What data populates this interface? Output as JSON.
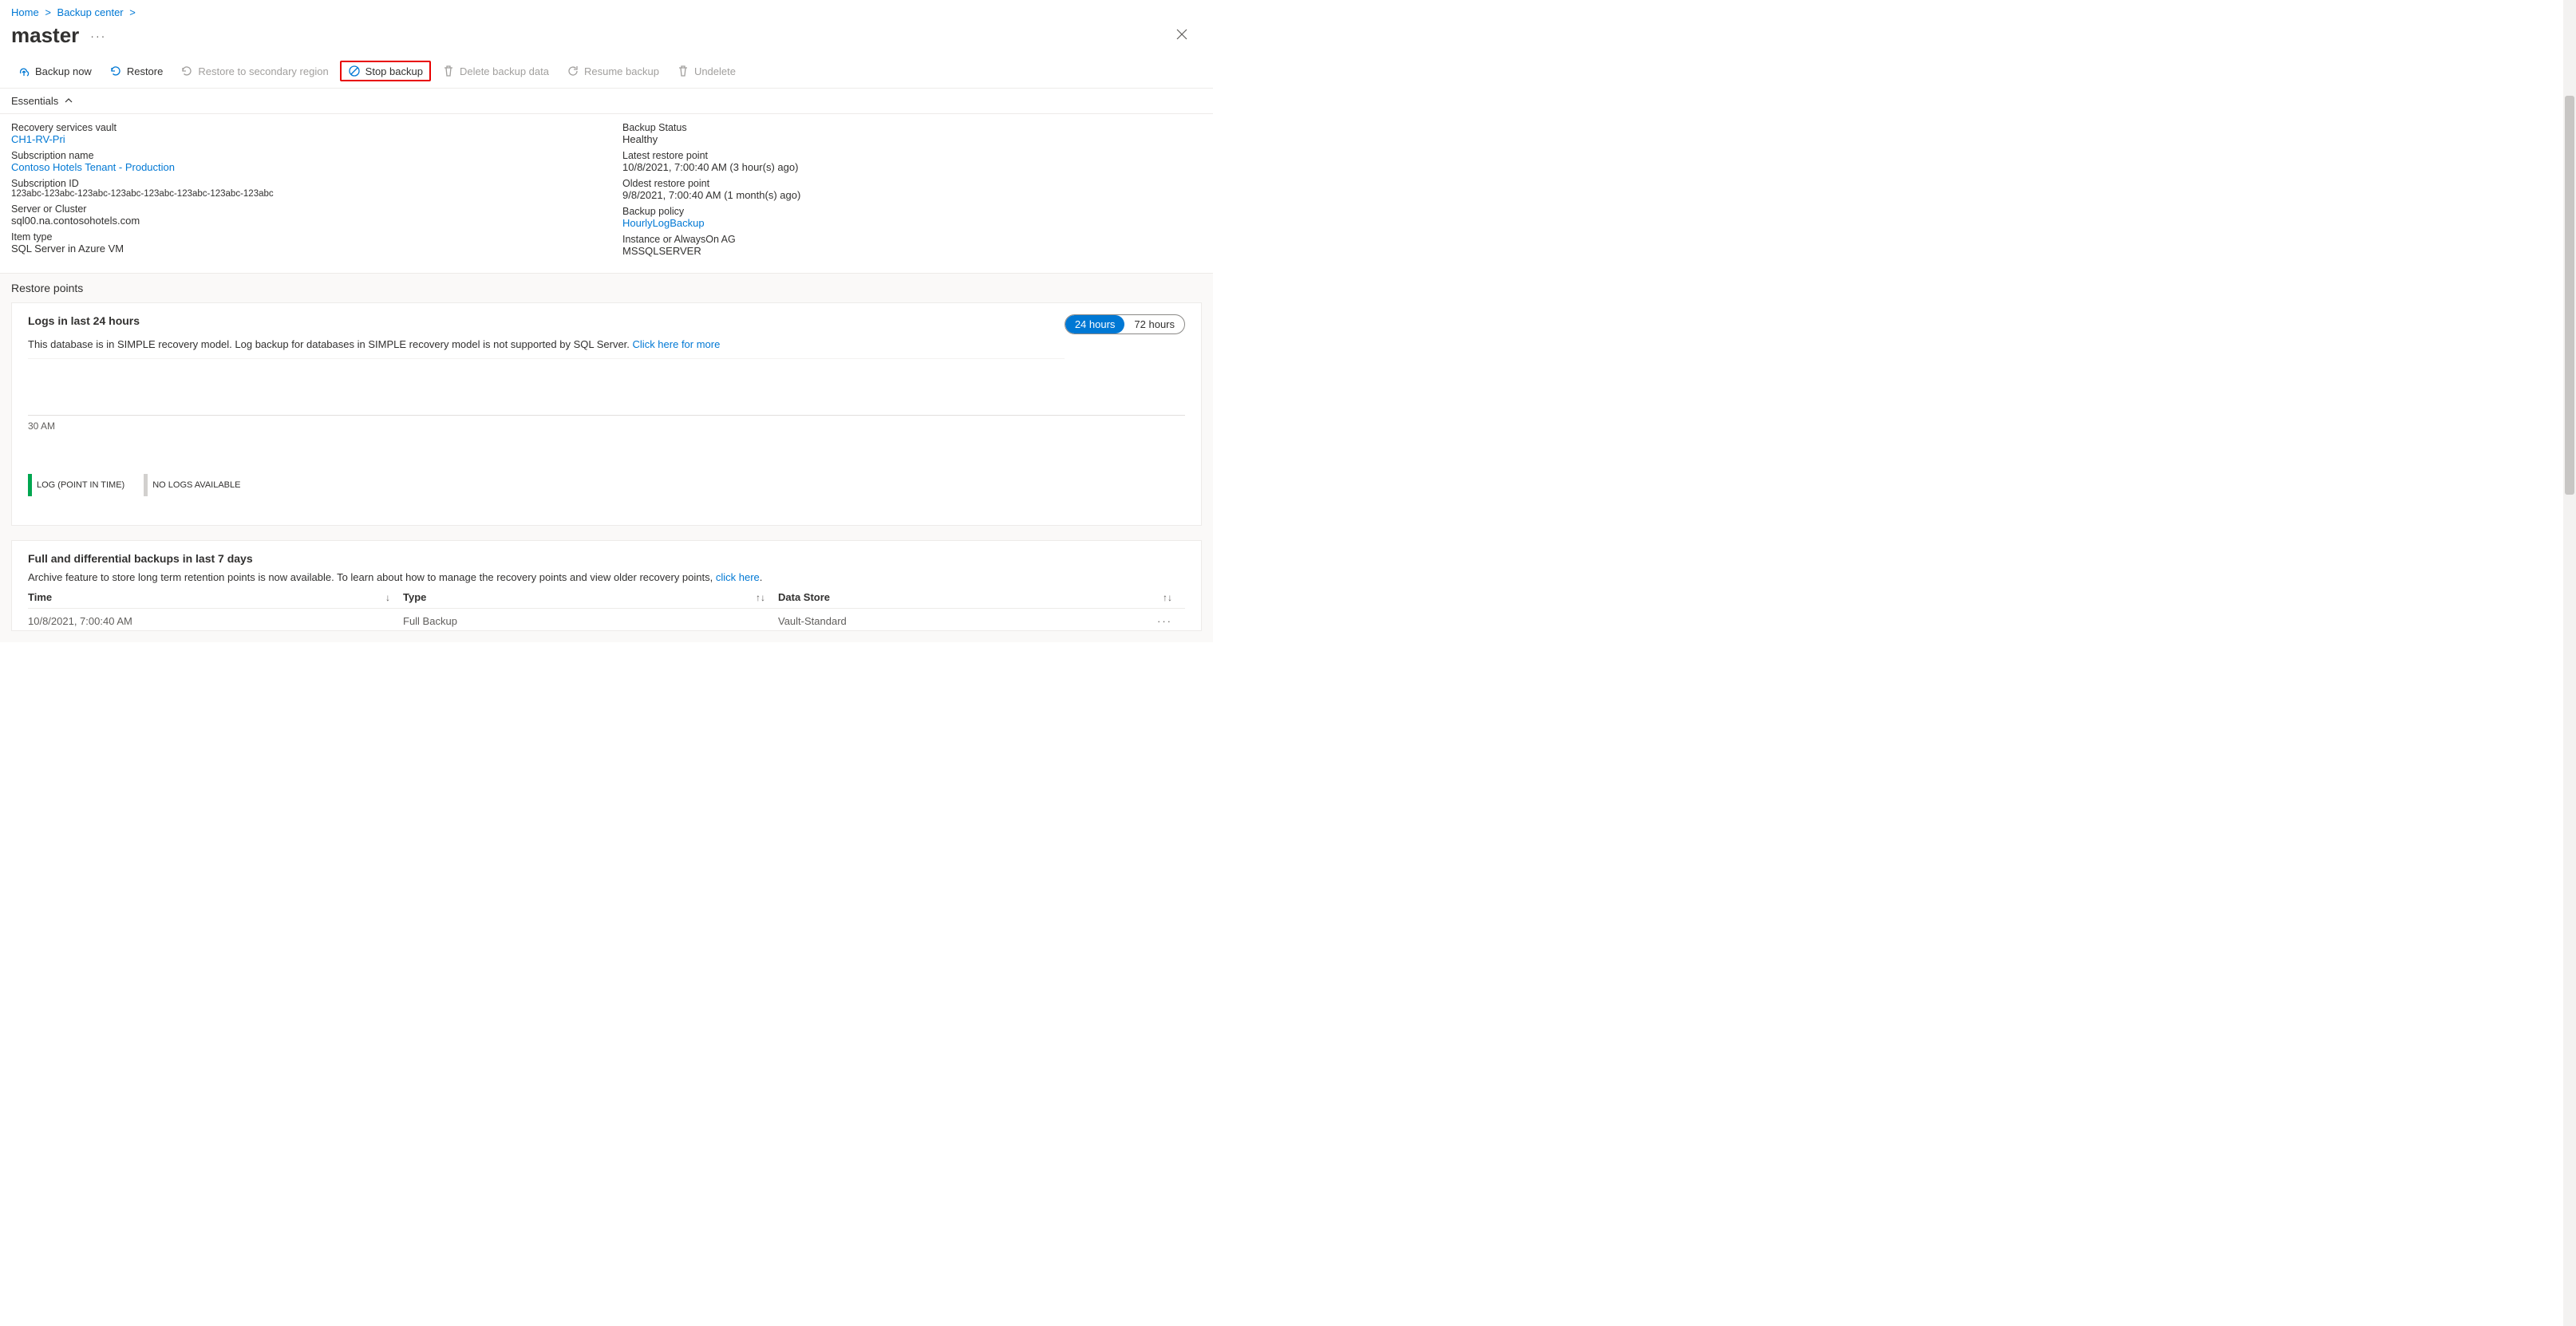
{
  "breadcrumb": {
    "home": "Home",
    "backup_center": "Backup center"
  },
  "title": "master",
  "toolbar": {
    "backup_now": "Backup now",
    "restore": "Restore",
    "restore_secondary": "Restore to secondary region",
    "stop_backup": "Stop backup",
    "delete_data": "Delete backup data",
    "resume_backup": "Resume backup",
    "undelete": "Undelete"
  },
  "essentials_label": "Essentials",
  "essentials": {
    "left": [
      {
        "label": "Recovery services vault",
        "value": "CH1-RV-Pri",
        "link": true
      },
      {
        "label": "Subscription name",
        "value": "Contoso Hotels Tenant - Production",
        "link": true
      },
      {
        "label": "Subscription ID",
        "value": "123abc-123abc-123abc-123abc-123abc-123abc-123abc-123abc",
        "mono": true
      },
      {
        "label": "Server or Cluster",
        "value": "sql00.na.contosohotels.com"
      },
      {
        "label": "Item type",
        "value": "SQL Server in Azure VM"
      }
    ],
    "right": [
      {
        "label": "Backup Status",
        "value": "Healthy"
      },
      {
        "label": "Latest restore point",
        "value": "10/8/2021, 7:00:40 AM (3 hour(s) ago)"
      },
      {
        "label": "Oldest restore point",
        "value": "9/8/2021, 7:00:40 AM (1 month(s) ago)"
      },
      {
        "label": "Backup policy",
        "value": "HourlyLogBackup",
        "link": true
      },
      {
        "label": "Instance or AlwaysOn AG",
        "value": "MSSQLSERVER"
      }
    ]
  },
  "restore_points_heading": "Restore points",
  "logs_card": {
    "title": "Logs in last 24 hours",
    "desc": "This database is in SIMPLE recovery model. Log backup for databases in SIMPLE recovery model is not supported by SQL Server.",
    "link_text": "Click here for more",
    "toggle": {
      "opt1": "24 hours",
      "opt2": "72 hours"
    },
    "tick": "30 AM",
    "legend": {
      "pit": "LOG (POINT IN TIME)",
      "none": "NO LOGS AVAILABLE"
    }
  },
  "fd_card": {
    "title": "Full and differential backups in last 7 days",
    "desc": "Archive feature to store long term retention points is now available. To learn about how to manage the recovery points and view older recovery points,",
    "link_text": "click here",
    "columns": {
      "time": "Time",
      "type": "Type",
      "ds": "Data Store"
    },
    "rows": [
      {
        "time": "10/8/2021, 7:00:40 AM",
        "type": "Full Backup",
        "ds": "Vault-Standard"
      }
    ]
  }
}
